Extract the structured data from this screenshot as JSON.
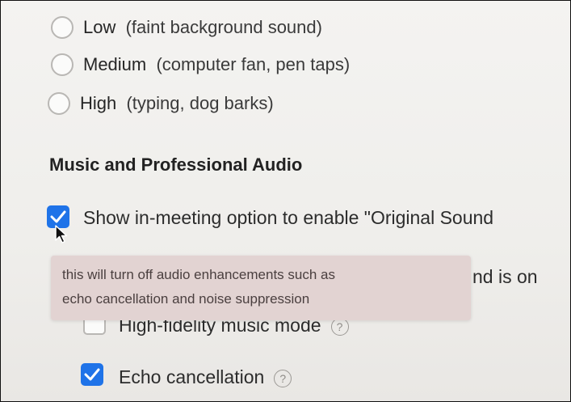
{
  "noise_levels": [
    {
      "name": "Low",
      "desc": "(faint background sound)"
    },
    {
      "name": "Medium",
      "desc": "(computer fan, pen taps)"
    },
    {
      "name": "High",
      "desc": "(typing, dog barks)"
    }
  ],
  "section_title": "Music and Professional Audio",
  "original_sound_option": {
    "label": "Show in-meeting option to enable \"Original Sound",
    "checked": true
  },
  "obscured_text": "nd is on",
  "tooltip": {
    "line1": "this will turn off audio enhancements such as",
    "line2": "echo cancellation and noise suppression"
  },
  "sub_options": [
    {
      "label": "High-fidelity music mode",
      "checked": false,
      "help": "?"
    },
    {
      "label": "Echo cancellation",
      "checked": true,
      "help": "?"
    }
  ],
  "colors": {
    "checkbox_accent": "#1f73e8",
    "tooltip_bg": "#e2d3d2"
  }
}
